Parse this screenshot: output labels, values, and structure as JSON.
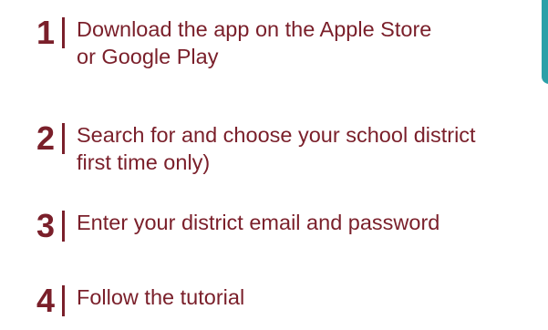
{
  "steps": [
    {
      "number": "1",
      "lines": [
        "Download the app on the Apple Store",
        "or Google Play"
      ]
    },
    {
      "number": "2",
      "lines": [
        "Search for and choose your school district",
        "first time only)"
      ]
    },
    {
      "number": "3",
      "lines": [
        "Enter your district email and password"
      ]
    },
    {
      "number": "4",
      "lines": [
        "Follow the tutorial"
      ]
    }
  ],
  "colors": {
    "accent": "#7a1f2a",
    "side_tab": "#2aa0a8"
  }
}
